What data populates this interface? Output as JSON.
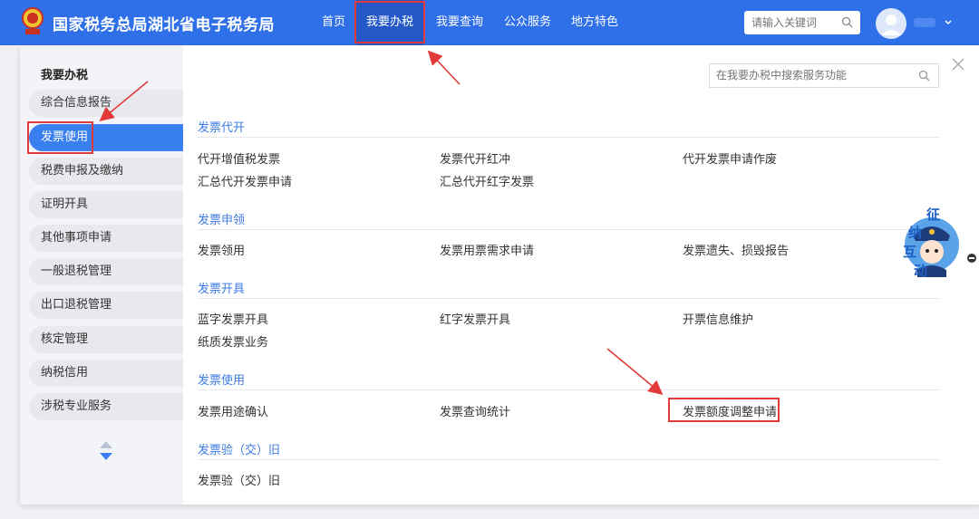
{
  "header": {
    "site_title": "国家税务总局湖北省电子税务局",
    "nav": [
      "首页",
      "我要办税",
      "我要查询",
      "公众服务",
      "地方特色"
    ],
    "search_placeholder": "请输入关键词"
  },
  "sidebar": {
    "title": "我要办税",
    "items": [
      "综合信息报告",
      "发票使用",
      "税费申报及缴纳",
      "证明开具",
      "其他事项申请",
      "一般退税管理",
      "出口退税管理",
      "核定管理",
      "纳税信用",
      "涉税专业服务"
    ],
    "active_index": 1
  },
  "main": {
    "search_placeholder": "在我要办税中搜索服务功能",
    "sections": [
      {
        "title": "发票代开",
        "links": [
          "代开增值税发票",
          "发票代开红冲",
          "代开发票申请作废",
          "汇总代开发票申请",
          "汇总代开红字发票"
        ]
      },
      {
        "title": "发票申领",
        "links": [
          "发票领用",
          "发票用票需求申请",
          "发票遗失、损毁报告"
        ]
      },
      {
        "title": "发票开具",
        "links": [
          "蓝字发票开具",
          "红字发票开具",
          "开票信息维护",
          "纸质发票业务"
        ]
      },
      {
        "title": "发票使用",
        "links": [
          "发票用途确认",
          "发票查询统计",
          "发票额度调整申请"
        ]
      },
      {
        "title": "发票验（交）旧",
        "links": [
          "发票验（交）旧"
        ]
      }
    ]
  },
  "mascot": {
    "text": [
      "征",
      "纳",
      "互",
      "动"
    ]
  },
  "colors": {
    "brand": "#2f6fe8",
    "accent": "#3a7ff0",
    "highlight": "#e23a3a",
    "section_title": "#3d7be3"
  }
}
